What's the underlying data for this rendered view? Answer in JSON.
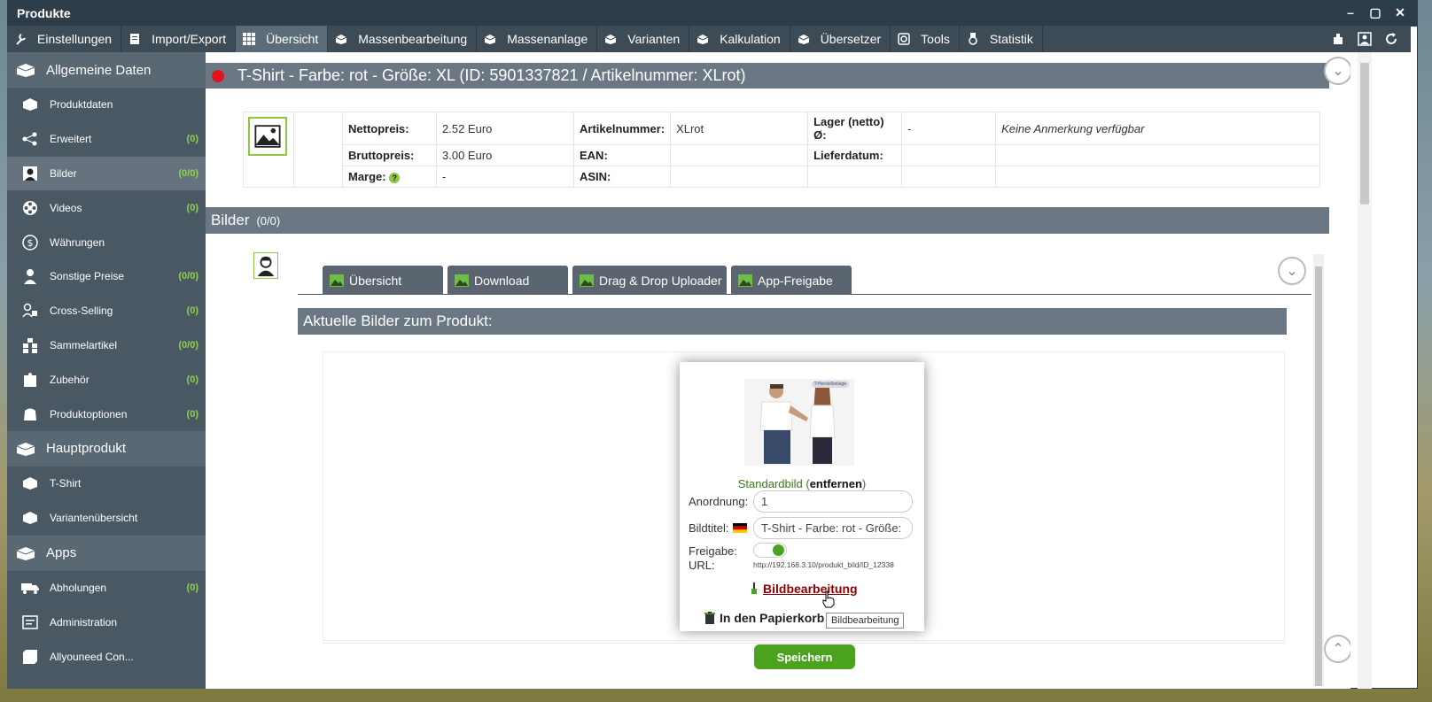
{
  "window": {
    "title": "Produkte"
  },
  "menu": [
    {
      "label": "Einstellungen",
      "icon": "wrench-icon"
    },
    {
      "label": "Import/Export",
      "icon": "document-icon"
    },
    {
      "label": "Übersicht",
      "icon": "grid-icon"
    },
    {
      "label": "Massenbearbeitung",
      "icon": "box-icon"
    },
    {
      "label": "Massenanlage",
      "icon": "box-icon"
    },
    {
      "label": "Varianten",
      "icon": "box-icon"
    },
    {
      "label": "Kalkulation",
      "icon": "box-icon"
    },
    {
      "label": "Übersetzer",
      "icon": "box-icon"
    },
    {
      "label": "Tools",
      "icon": "tools-icon"
    },
    {
      "label": "Statistik",
      "icon": "medal-icon"
    }
  ],
  "sidebar": {
    "sections": [
      {
        "title": "Allgemeine Daten"
      },
      {
        "title": "Hauptprodukt"
      },
      {
        "title": "Apps"
      }
    ],
    "general": [
      {
        "label": "Produktdaten",
        "count": ""
      },
      {
        "label": "Erweitert",
        "count": "(0)"
      },
      {
        "label": "Bilder",
        "count": "(0/0)"
      },
      {
        "label": "Videos",
        "count": "(0)"
      },
      {
        "label": "Währungen",
        "count": ""
      },
      {
        "label": "Sonstige Preise",
        "count": "(0/0)"
      },
      {
        "label": "Cross-Selling",
        "count": "(0)"
      },
      {
        "label": "Sammelartikel",
        "count": "(0/0)"
      },
      {
        "label": "Zubehör",
        "count": "(0)"
      },
      {
        "label": "Produktoptionen",
        "count": "(0)"
      }
    ],
    "main": [
      {
        "label": "T-Shirt"
      },
      {
        "label": "Variantenübersicht"
      }
    ],
    "apps": [
      {
        "label": "Abholungen",
        "count": "(0)"
      },
      {
        "label": "Administration",
        "count": ""
      },
      {
        "label": "Allyouneed Con...",
        "count": ""
      }
    ]
  },
  "product": {
    "title": "T-Shirt - Farbe: rot - Größe: XL (ID: 5901337821 / Artikelnummer: XLrot)",
    "status_color": "#e0141c",
    "nettopreis_label": "Nettopreis:",
    "nettopreis": "2.52 Euro",
    "bruttopreis_label": "Bruttopreis:",
    "bruttopreis": "3.00 Euro",
    "marge_label": "Marge:",
    "marge": "-",
    "artikelnummer_label": "Artikelnummer:",
    "artikelnummer": "XLrot",
    "ean_label": "EAN:",
    "ean": "",
    "asin_label": "ASIN:",
    "asin": "",
    "lager_label": "Lager (netto) Ø:",
    "lager": "-",
    "lieferdatum_label": "Lieferdatum:",
    "lieferdatum": "",
    "anmerkung": "Keine Anmerkung verfügbar"
  },
  "bilder": {
    "title": "Bilder",
    "count": "(0/0)",
    "tabs": [
      "Übersicht",
      "Download",
      "Drag & Drop Uploader",
      "App-Freigabe"
    ],
    "current_title": "Aktuelle Bilder zum Produkt:",
    "card": {
      "badge": "T-Herstellanlage",
      "standard_label": "Standardbild",
      "remove_label": "entfernen",
      "anordnung_label": "Anordnung:",
      "anordnung_value": "1",
      "bildtitel_label": "Bildtitel:",
      "bildtitel_value": "T-Shirt - Farbe: rot - Größe:",
      "freigabe_label": "Freigabe:",
      "freigabe_on": true,
      "url_label": "URL:",
      "url_value": "http://192.168.3.10/produkt_bild/ID_12338",
      "edit_label": "Bildbearbeitung",
      "trash_label": "In den Papierkorb",
      "tooltip": "Bildbearbeitung"
    },
    "save_label": "Speichern"
  },
  "colors": {
    "accent_green": "#4aa21e",
    "count_green": "#8fd14f",
    "header_gray": "#6b7883",
    "sidebar": "#4a5864"
  }
}
